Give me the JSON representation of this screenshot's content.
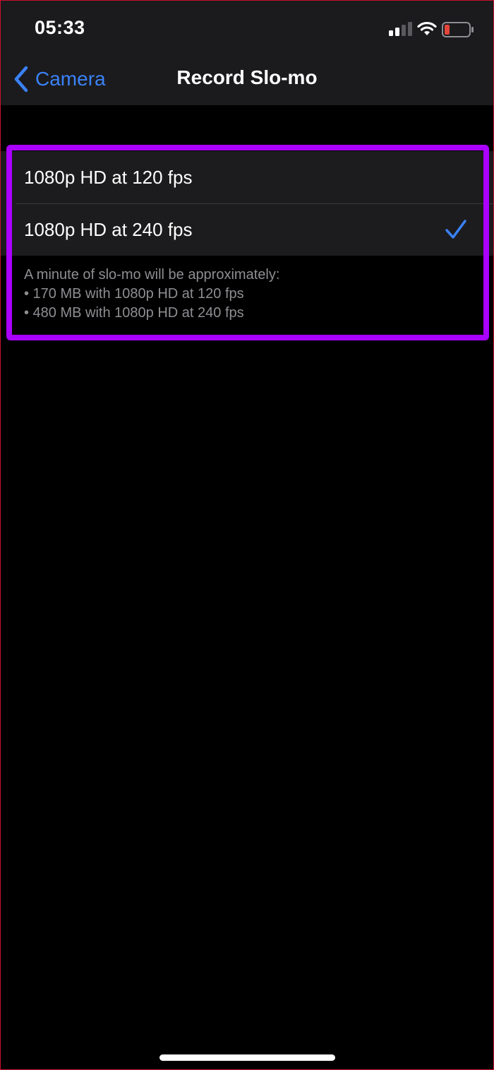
{
  "status_bar": {
    "time": "05:33",
    "icons": [
      "signal-icon",
      "wifi-icon",
      "battery-icon"
    ],
    "battery_color": "#e5443b"
  },
  "nav": {
    "back_label": "Camera",
    "back_icon": "chevron-left-icon",
    "title": "Record Slo-mo",
    "accent_color": "#3a82f7"
  },
  "options": [
    {
      "label": "1080p HD at 120 fps",
      "selected": false
    },
    {
      "label": "1080p HD at 240 fps",
      "selected": true
    }
  ],
  "footer": {
    "lines": [
      "A minute of slo-mo will be approximately:",
      "• 170 MB with 1080p HD at 120 fps",
      "• 480 MB with 1080p HD at 240 fps"
    ]
  },
  "highlight_color": "#aa00ff"
}
